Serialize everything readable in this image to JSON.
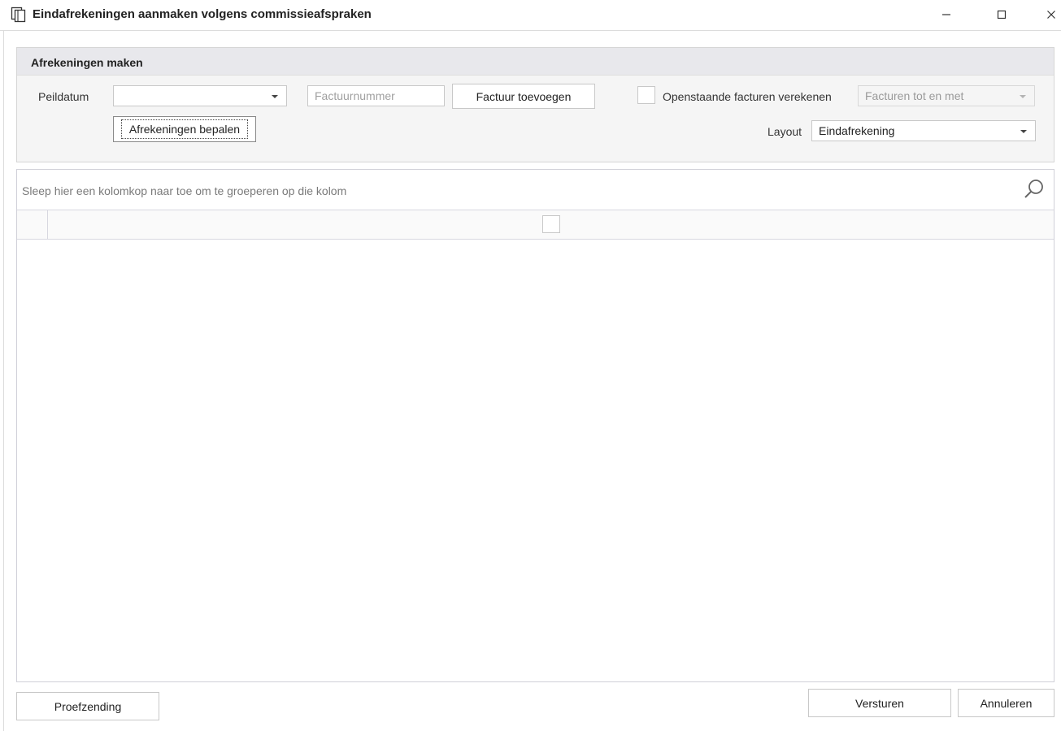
{
  "window": {
    "title": "Eindafrekeningen aanmaken volgens commissieafspraken",
    "minimize_glyph": "–",
    "maximize_glyph": "☐",
    "close_glyph": "×"
  },
  "panel": {
    "title": "Afrekeningen maken",
    "peildatum_label": "Peildatum",
    "peildatum_value": "",
    "factuurnummer_placeholder": "Factuurnummer",
    "factuur_toevoegen_label": "Factuur toevoegen",
    "openstaande_label": "Openstaande facturen verekenen",
    "openstaande_checked": false,
    "facturen_tot_value": "Facturen tot en met",
    "afrekeningen_bepalen_label": "Afrekeningen bepalen",
    "layout_label": "Layout",
    "layout_value": "Eindafrekening"
  },
  "grid": {
    "group_hint": "Sleep hier een kolomkop naar toe om te groeperen op die kolom",
    "search_icon": "magnifier-icon",
    "rows": []
  },
  "footer": {
    "proefzending_label": "Proefzending",
    "versturen_label": "Versturen",
    "annuleren_label": "Annuleren"
  },
  "icons": {
    "app": "copy-documents-icon"
  }
}
